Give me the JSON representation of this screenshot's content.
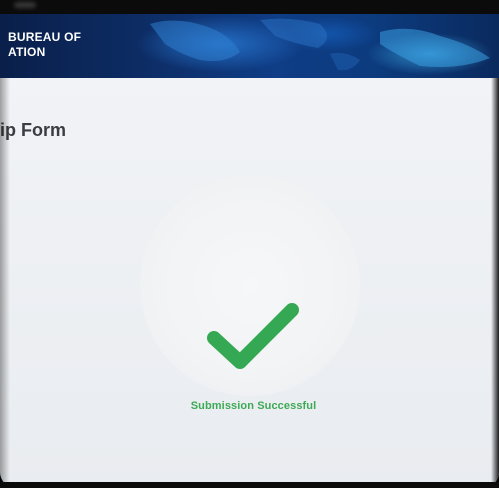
{
  "header": {
    "org_line_1": "BUREAU OF",
    "org_line_2": "ATION"
  },
  "form": {
    "title": "Tip Form",
    "title_visible": "ip Form"
  },
  "status": {
    "message": "Submission Successful",
    "icon": "checkmark-icon",
    "color": "#3daa55"
  },
  "colors": {
    "banner": "#0d2d66",
    "panel": "#f1f3f6"
  }
}
